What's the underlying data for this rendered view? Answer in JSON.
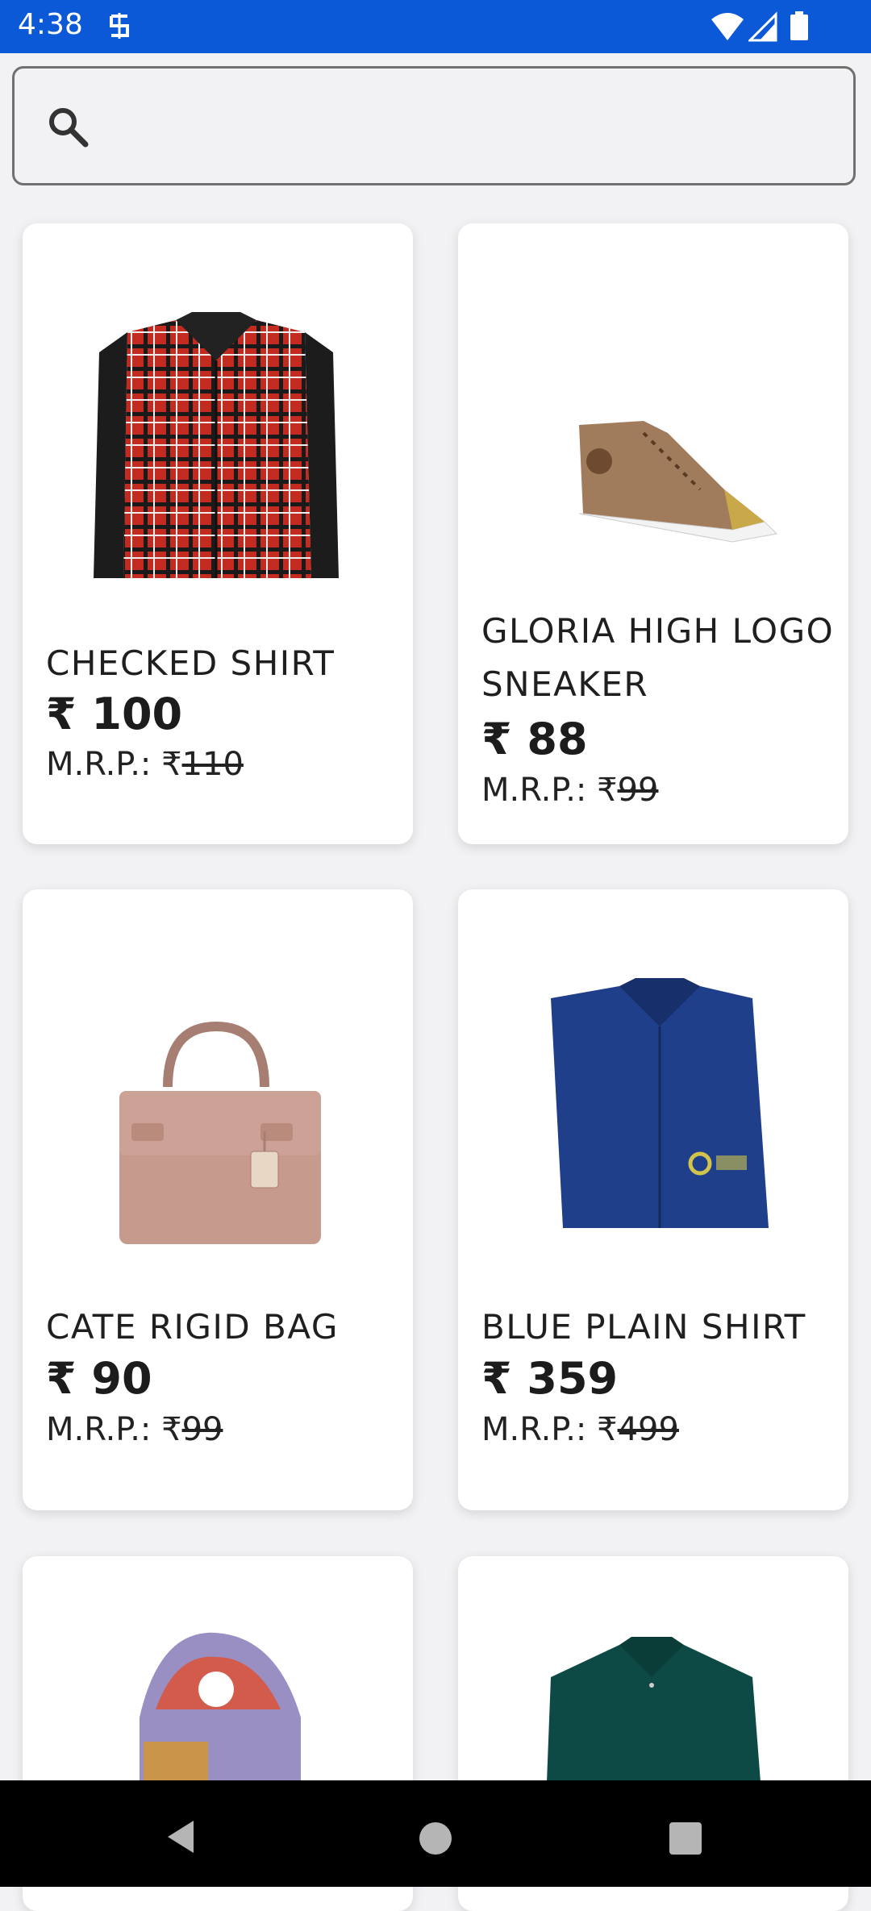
{
  "status": {
    "time": "4:38"
  },
  "search": {
    "placeholder": ""
  },
  "products": [
    {
      "title": "CHECKED SHIRT",
      "price": "₹ 100",
      "mrp_label": "M.R.P.: ₹",
      "mrp_value": "110",
      "image": "checked-shirt"
    },
    {
      "title": "GLORIA HIGH LOGO SNEAKER",
      "price": "₹ 88",
      "mrp_label": "M.R.P.: ₹",
      "mrp_value": "99",
      "image": "sneaker"
    },
    {
      "title": "CATE RIGID BAG",
      "price": "₹ 90",
      "mrp_label": "M.R.P.: ₹",
      "mrp_value": "99",
      "image": "bag"
    },
    {
      "title": "BLUE PLAIN SHIRT",
      "price": "₹ 359",
      "mrp_label": "M.R.P.: ₹",
      "mrp_value": "499",
      "image": "blue-shirt"
    }
  ],
  "colors": {
    "status_bar": "#0b59d6",
    "background": "#f2f2f5",
    "card": "#ffffff"
  }
}
